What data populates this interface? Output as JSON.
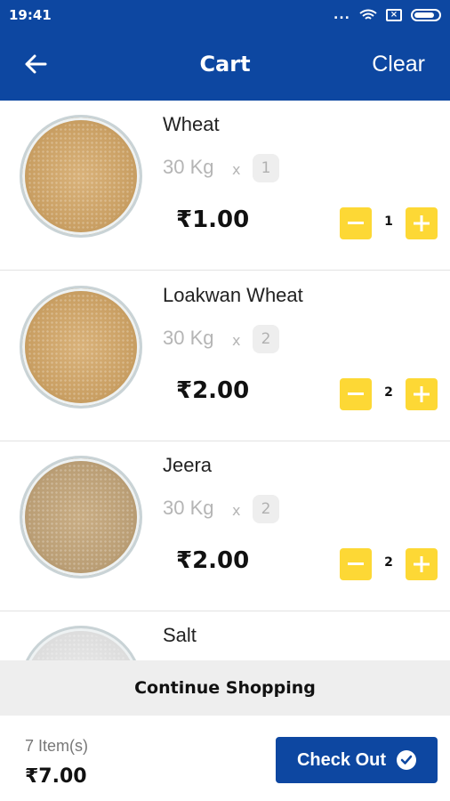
{
  "status_bar": {
    "time": "19:41",
    "dots": "...",
    "sim_icon": "sim-x-icon",
    "wifi_icon": "wifi-icon",
    "battery_icon": "battery-icon"
  },
  "app_bar": {
    "title": "Cart",
    "clear_label": "Clear",
    "back_icon": "arrow-left-icon"
  },
  "colors": {
    "primary": "#0d47a1",
    "accent": "#fdd835",
    "divider": "#e2e2e2"
  },
  "items": [
    {
      "name": "Wheat",
      "unit": "30 Kg",
      "times": "x",
      "quantity": "1",
      "price": "₹1.00",
      "stepper_value": "1"
    },
    {
      "name": "Loakwan Wheat",
      "unit": "30 Kg",
      "times": "x",
      "quantity": "2",
      "price": "₹2.00",
      "stepper_value": "2"
    },
    {
      "name": "Jeera",
      "unit": "30 Kg",
      "times": "x",
      "quantity": "2",
      "price": "₹2.00",
      "stepper_value": "2"
    },
    {
      "name": "Salt"
    }
  ],
  "continue_label": "Continue Shopping",
  "footer": {
    "item_count": "7 Item(s)",
    "total": "₹7.00",
    "checkout_label": "Check Out",
    "checkout_icon": "check-circle-icon"
  }
}
